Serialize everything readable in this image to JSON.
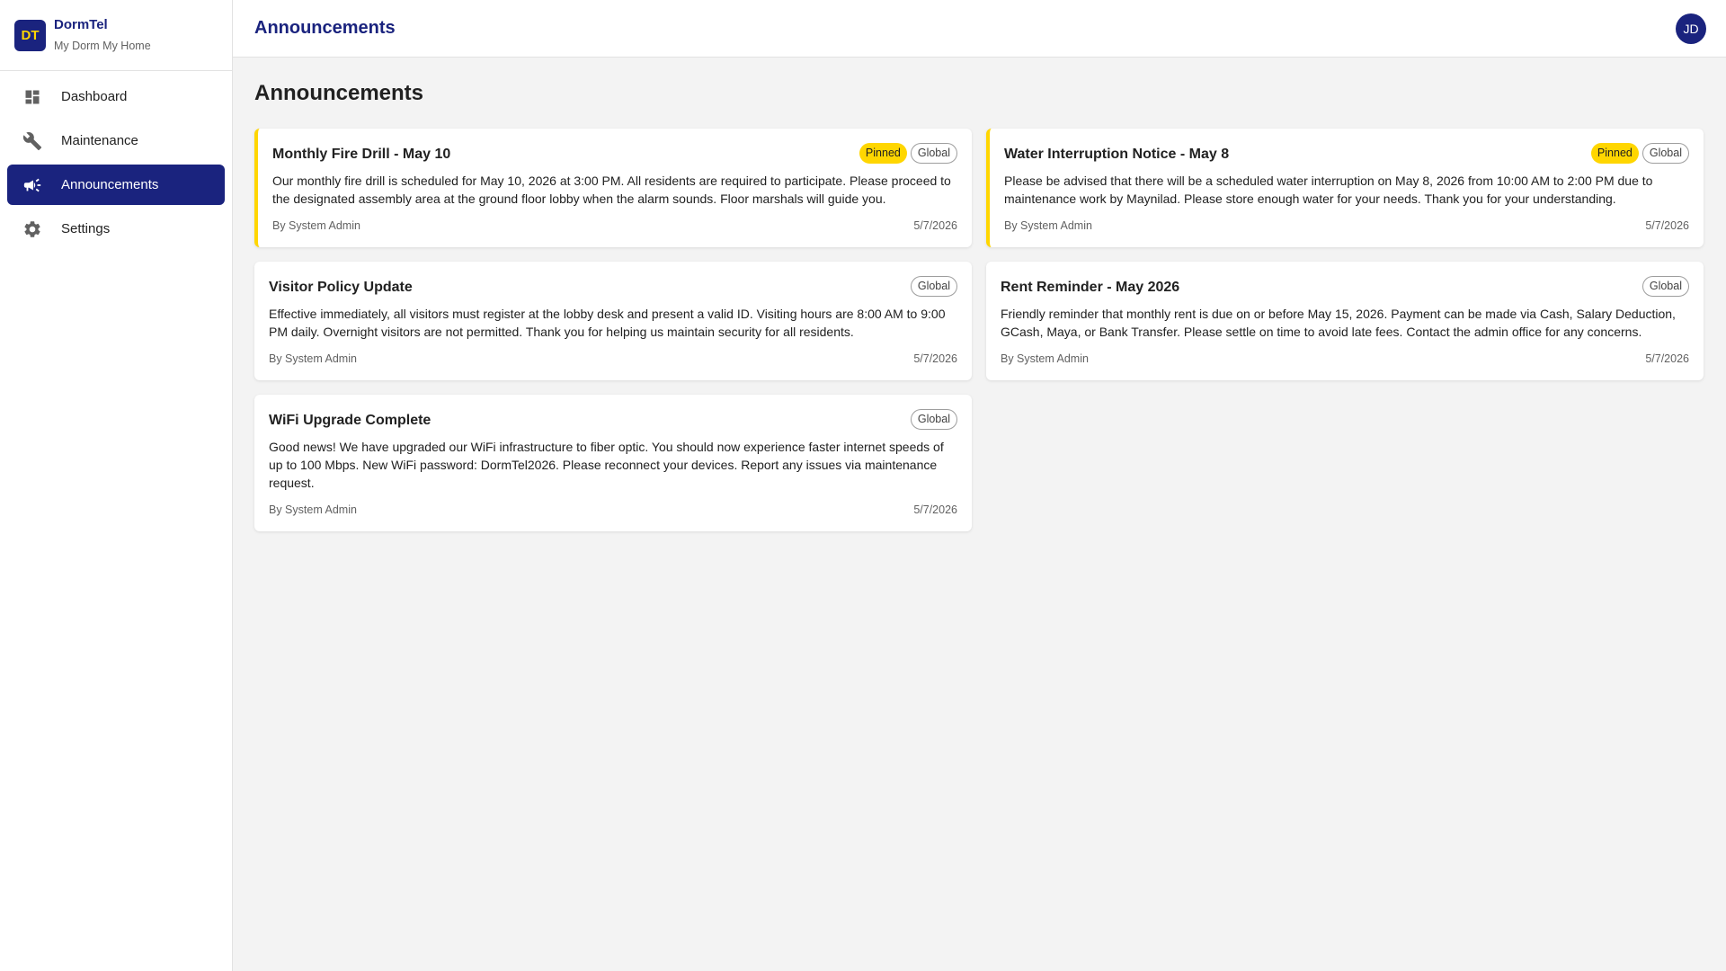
{
  "brand": {
    "logo": "DT",
    "name": "DormTel",
    "tagline": "My Dorm My Home"
  },
  "sidebar": {
    "items": [
      {
        "label": "Dashboard",
        "icon": "dashboard-icon",
        "active": false
      },
      {
        "label": "Maintenance",
        "icon": "wrench-icon",
        "active": false
      },
      {
        "label": "Announcements",
        "icon": "megaphone-icon",
        "active": true
      },
      {
        "label": "Settings",
        "icon": "gear-icon",
        "active": false
      }
    ]
  },
  "header": {
    "title": "Announcements",
    "avatar": "JD"
  },
  "main": {
    "title": "Announcements",
    "announcements": [
      {
        "title": "Monthly Fire Drill - May 10",
        "pinned_label": "Pinned",
        "scope": "Global",
        "body": "Our monthly fire drill is scheduled for May 10, 2026 at 3:00 PM. All residents are required to participate. Please proceed to the designated assembly area at the ground floor lobby when the alarm sounds. Floor marshals will guide you.",
        "author": "By System Admin",
        "date": "5/7/2026"
      },
      {
        "title": "Water Interruption Notice - May 8",
        "pinned_label": "Pinned",
        "scope": "Global",
        "body": "Please be advised that there will be a scheduled water interruption on May 8, 2026 from 10:00 AM to 2:00 PM due to maintenance work by Maynilad. Please store enough water for your needs. Thank you for your understanding.",
        "author": "By System Admin",
        "date": "5/7/2026"
      },
      {
        "title": "Visitor Policy Update",
        "scope": "Global",
        "body": "Effective immediately, all visitors must register at the lobby desk and present a valid ID. Visiting hours are 8:00 AM to 9:00 PM daily. Overnight visitors are not permitted. Thank you for helping us maintain security for all residents.",
        "author": "By System Admin",
        "date": "5/7/2026"
      },
      {
        "title": "Rent Reminder - May 2026",
        "scope": "Global",
        "body": "Friendly reminder that monthly rent is due on or before May 15, 2026. Payment can be made via Cash, Salary Deduction, GCash, Maya, or Bank Transfer. Please settle on time to avoid late fees. Contact the admin office for any concerns.",
        "author": "By System Admin",
        "date": "5/7/2026"
      },
      {
        "title": "WiFi Upgrade Complete",
        "scope": "Global",
        "body": "Good news! We have upgraded our WiFi infrastructure to fiber optic. You should now experience faster internet speeds of up to 100 Mbps. New WiFi password: DormTel2026. Please reconnect your devices. Report any issues via maintenance request.",
        "author": "By System Admin",
        "date": "5/7/2026"
      }
    ]
  },
  "colors": {
    "primary": "#1a237e",
    "accent": "#ffd600",
    "background": "#f3f3f3"
  }
}
